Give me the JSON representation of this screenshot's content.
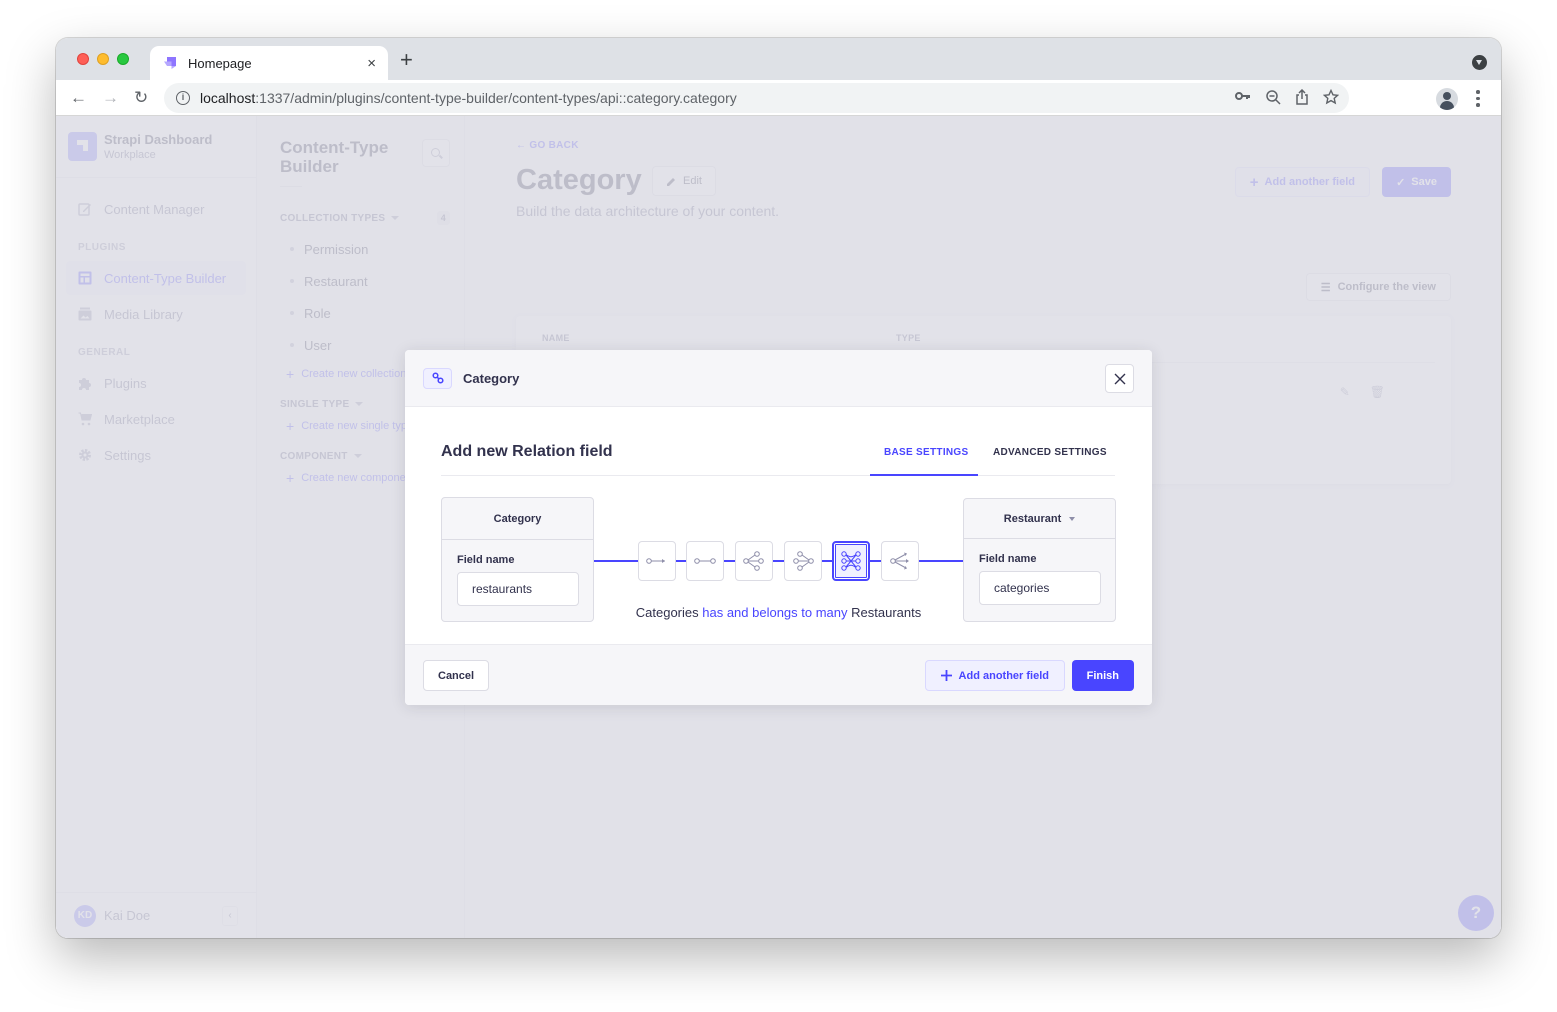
{
  "browser": {
    "tab_title": "Homepage",
    "url_host": "localhost",
    "url_path": ":1337/admin/plugins/content-type-builder/content-types/api::category.category",
    "new_tab_symbol": "+",
    "tab_close_symbol": "×",
    "nav_back": "←",
    "nav_forward": "→",
    "nav_reload": "↻",
    "omni_icons": [
      "key-icon",
      "zoom-out-icon",
      "share-icon",
      "star-icon"
    ]
  },
  "sidebar": {
    "brand_name": "Strapi Dashboard",
    "brand_sub": "Workplace",
    "content_manager": "Content Manager",
    "plugins_section": "PLUGINS",
    "content_type_builder": "Content-Type Builder",
    "media_library": "Media Library",
    "general_section": "GENERAL",
    "plugins": "Plugins",
    "marketplace": "Marketplace",
    "settings": "Settings",
    "user_initials": "KD",
    "user_name": "Kai Doe"
  },
  "ctb": {
    "title": "Content-Type Builder",
    "collection_types_label": "COLLECTION TYPES",
    "collection_count": "4",
    "collection_items": [
      "Permission",
      "Restaurant",
      "Role",
      "User"
    ],
    "create_collection": "Create new collection type",
    "single_type_label": "SINGLE TYPE",
    "create_single": "Create new single type",
    "component_label": "COMPONENT",
    "create_component": "Create new component"
  },
  "main": {
    "go_back": "GO BACK",
    "title": "Category",
    "edit": "Edit",
    "subtitle": "Build the data architecture of your content.",
    "add_another_field": "Add another field",
    "save": "Save",
    "configure_view": "Configure the view",
    "table_headers": [
      "NAME",
      "TYPE"
    ]
  },
  "modal": {
    "header_title": "Category",
    "heading": "Add new Relation field",
    "tab_base": "BASE SETTINGS",
    "tab_advanced": "ADVANCED SETTINGS",
    "left_type": "Category",
    "left_field_label": "Field name",
    "left_field_value": "restaurants",
    "right_type": "Restaurant",
    "right_field_label": "Field name",
    "right_field_value": "categories",
    "relation_types": [
      {
        "name": "one-way",
        "active": false
      },
      {
        "name": "one-to-one",
        "active": false
      },
      {
        "name": "one-to-many",
        "active": false
      },
      {
        "name": "many-to-one",
        "active": false
      },
      {
        "name": "many-to-many",
        "active": true
      },
      {
        "name": "many-way",
        "active": false
      }
    ],
    "desc_left": "Categories",
    "desc_relation": "has and belongs to many",
    "desc_right": "Restaurants",
    "cancel": "Cancel",
    "add_another_field": "Add another field",
    "finish": "Finish"
  },
  "help": {
    "label": "?"
  },
  "colors": {
    "primary": "#4945ff",
    "primary_light": "#f0f0ff",
    "text_dark": "#32324d",
    "text_muted": "#666687"
  }
}
